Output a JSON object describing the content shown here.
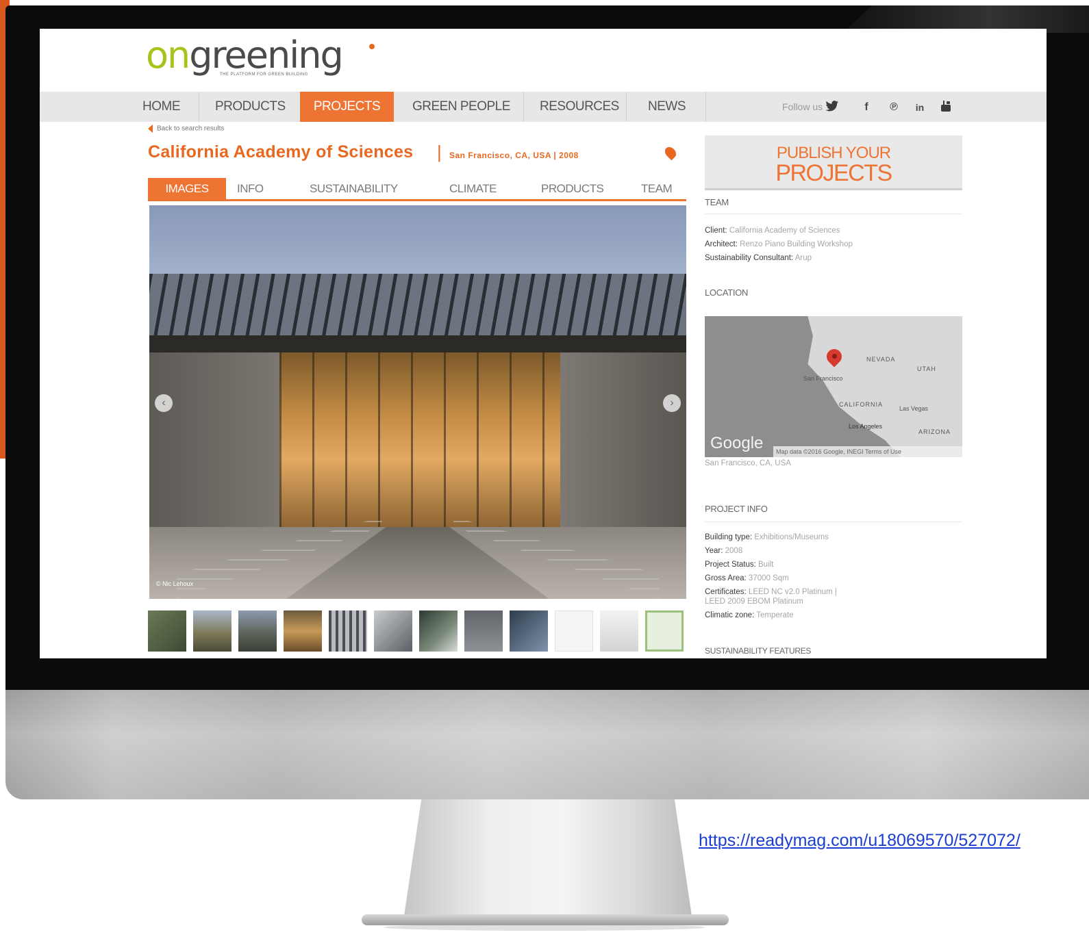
{
  "site": {
    "logo_on": "on",
    "logo_rest": "greening",
    "logo_tagline": "THE PLATFORM FOR GREEN BUILDING",
    "accent_color": "#ee7434",
    "logo_green": "#a8c31c"
  },
  "nav": {
    "items": [
      {
        "label": "HOME"
      },
      {
        "label": "PRODUCTS"
      },
      {
        "label": "PROJECTS",
        "active": true
      },
      {
        "label": "GREEN PEOPLE"
      },
      {
        "label": "RESOURCES"
      },
      {
        "label": "NEWS"
      }
    ],
    "follow_label": "Follow us",
    "social_icons": [
      "twitter-icon",
      "facebook-icon",
      "pinterest-icon",
      "linkedin-icon",
      "youtube-icon"
    ]
  },
  "back_link": "Back to search results",
  "project": {
    "title": "California Academy of Sciences",
    "separator": "|",
    "location_year": "San Francisco, CA, USA | 2008"
  },
  "project_tabs": [
    {
      "label": "IMAGES",
      "active": true
    },
    {
      "label": "INFO"
    },
    {
      "label": "SUSTAINABILITY"
    },
    {
      "label": "CLIMATE"
    },
    {
      "label": "PRODUCTS"
    },
    {
      "label": "TEAM"
    }
  ],
  "hero": {
    "credit": "© Nic Lehoux",
    "prev_symbol": "‹",
    "next_symbol": "›"
  },
  "thumbnails_count": 12,
  "sidebar": {
    "publish_line1": "PUBLISH YOUR",
    "publish_line2": "PROJECTS",
    "team_heading": "TEAM",
    "team": [
      {
        "key": "Client:",
        "value": "California Academy of Sciences"
      },
      {
        "key": "Architect:",
        "value": "Renzo Piano Building Workshop"
      },
      {
        "key": "Sustainability Consultant:",
        "value": "Arup"
      }
    ],
    "location_heading": "LOCATION",
    "map": {
      "labels": [
        "NEVADA",
        "UTAH",
        "San Francisco",
        "CALIFORNIA",
        "Las Vegas",
        "Los Angeles",
        "ARIZONA"
      ],
      "google": "Google",
      "footer": "Map data ©2016 Google, INEGI    Terms of Use"
    },
    "location_text": "San Francisco, CA, USA",
    "info_heading": "PROJECT INFO",
    "info": [
      {
        "key": "Building type:",
        "value": "Exhibitions/Museums"
      },
      {
        "key": "Year:",
        "value": "2008"
      },
      {
        "key": "Project Status:",
        "value": "Built"
      },
      {
        "key": "Gross Area:",
        "value": "37000 Sqm"
      },
      {
        "key": "Certificates:",
        "value": "LEED NC v2.0 Platinum |"
      },
      {
        "key": "",
        "value": "LEED 2009 EBOM Platinum"
      },
      {
        "key": "Climatic zone:",
        "value": "Temperate"
      }
    ],
    "sustain_heading": "SUSTAINABILITY FEATURES"
  },
  "page_url": "https://readymag.com/u18069570/527072/"
}
